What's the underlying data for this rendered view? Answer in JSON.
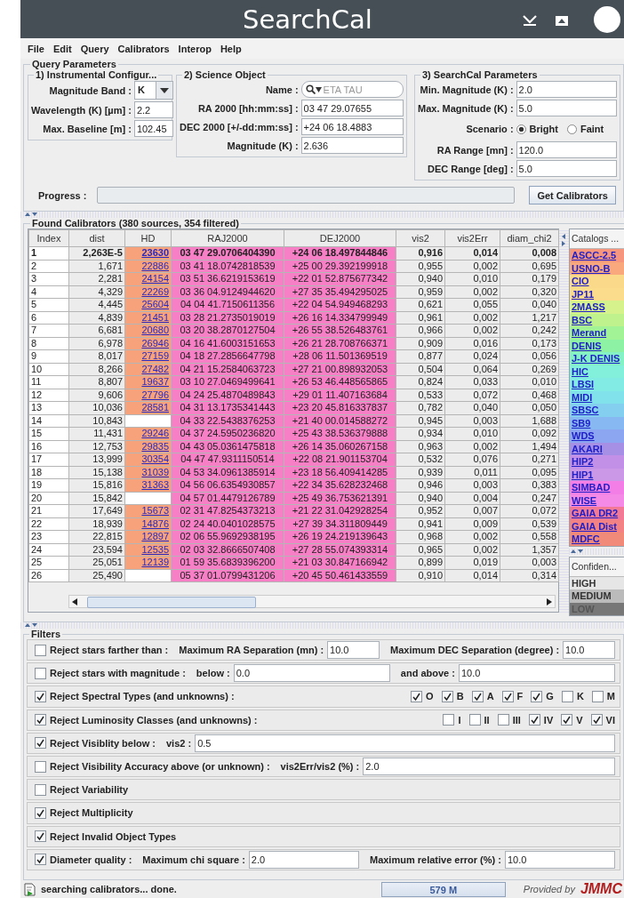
{
  "window": {
    "title": "SearchCal"
  },
  "menu": [
    "File",
    "Edit",
    "Query",
    "Calibrators",
    "Interop",
    "Help"
  ],
  "query_parameters": {
    "title": "Query Parameters",
    "instrumental": {
      "title": "1) Instrumental Configur...",
      "fields": [
        {
          "kind": "combo",
          "label": "Magnitude Band :",
          "value": "K"
        },
        {
          "kind": "text",
          "label": "Wavelength (K) [µm] :",
          "value": "2.2"
        },
        {
          "kind": "text",
          "label": "Max. Baseline [m] :",
          "value": "102.45"
        }
      ]
    },
    "science_object": {
      "title": "2) Science Object",
      "fields": [
        {
          "kind": "search",
          "label": "Name :",
          "placeholder": "ETA TAU"
        },
        {
          "kind": "text",
          "label": "RA 2000 [hh:mm:ss] :",
          "value": "03 47 29.07655"
        },
        {
          "kind": "text",
          "label": "DEC 2000 [+/-dd:mm:ss] :",
          "value": "+24 06 18.4883"
        },
        {
          "kind": "text",
          "label": "Magnitude (K) :",
          "value": "2.636"
        }
      ]
    },
    "searchcal": {
      "title": "3) SearchCal Parameters",
      "fields": [
        {
          "kind": "text",
          "label": "Min. Magnitude (K) :",
          "value": "2.0"
        },
        {
          "kind": "text",
          "label": "Max. Magnitude (K) :",
          "value": "5.0"
        },
        {
          "kind": "radio",
          "label": "Scenario :",
          "options": [
            {
              "label": "Bright",
              "selected": true
            },
            {
              "label": "Faint",
              "selected": false
            }
          ]
        },
        {
          "kind": "text",
          "label": "RA Range [mn] :",
          "value": "120.0"
        },
        {
          "kind": "text",
          "label": "DEC Range [deg] :",
          "value": "5.0"
        }
      ]
    },
    "progress_label": "Progress :",
    "button": "Get Calibrators"
  },
  "results": {
    "title": "Found Calibrators (380 sources, 354 filtered)",
    "columns": [
      "Index",
      "dist",
      "HD",
      "RAJ2000",
      "DEJ2000",
      "vis2",
      "vis2Err",
      "diam_chi2"
    ],
    "rows": [
      {
        "bold": true,
        "index": "1",
        "dist": "2,263E-5",
        "hd": "23630",
        "raj2000": "03 47 29.0706404390",
        "dej2000": "+24 06 18.497844846",
        "vis2": "0,916",
        "vis2err": "0,014",
        "diam_chi2": "0,008"
      },
      {
        "bold": false,
        "index": "2",
        "dist": "1,671",
        "hd": "22886",
        "raj2000": "03 41 18.0742818539",
        "dej2000": "+25 00 29.392199918",
        "vis2": "0,955",
        "vis2err": "0,002",
        "diam_chi2": "0,695"
      },
      {
        "bold": false,
        "index": "3",
        "dist": "2,281",
        "hd": "24154",
        "raj2000": "03 51 36.6219153619",
        "dej2000": "+22 01 52.875677342",
        "vis2": "0,940",
        "vis2err": "0,010",
        "diam_chi2": "0,179"
      },
      {
        "bold": false,
        "index": "4",
        "dist": "4,329",
        "hd": "22269",
        "raj2000": "03 36 04.9124944620",
        "dej2000": "+27 35 35.494295025",
        "vis2": "0,959",
        "vis2err": "0,002",
        "diam_chi2": "0,320"
      },
      {
        "bold": false,
        "index": "5",
        "dist": "4,445",
        "hd": "25604",
        "raj2000": "04 04 41.7150611356",
        "dej2000": "+22 04 54.949468293",
        "vis2": "0,621",
        "vis2err": "0,055",
        "diam_chi2": "0,040"
      },
      {
        "bold": false,
        "index": "6",
        "dist": "4,839",
        "hd": "21451",
        "raj2000": "03 28 21.2735019019",
        "dej2000": "+26 16 14.334799949",
        "vis2": "0,961",
        "vis2err": "0,002",
        "diam_chi2": "1,217"
      },
      {
        "bold": false,
        "index": "7",
        "dist": "6,681",
        "hd": "20680",
        "raj2000": "03 20 38.2870127504",
        "dej2000": "+26 55 38.526483761",
        "vis2": "0,966",
        "vis2err": "0,002",
        "diam_chi2": "0,242"
      },
      {
        "bold": false,
        "index": "8",
        "dist": "6,978",
        "hd": "26946",
        "raj2000": "04 16 41.6003151653",
        "dej2000": "+26 21 28.708766371",
        "vis2": "0,909",
        "vis2err": "0,016",
        "diam_chi2": "0,173"
      },
      {
        "bold": false,
        "index": "9",
        "dist": "8,017",
        "hd": "27159",
        "raj2000": "04 18 27.2856647798",
        "dej2000": "+28 06 11.501369519",
        "vis2": "0,877",
        "vis2err": "0,024",
        "diam_chi2": "0,056"
      },
      {
        "bold": false,
        "index": "10",
        "dist": "8,266",
        "hd": "27482",
        "raj2000": "04 21 15.2584063723",
        "dej2000": "+27 21 00.898932053",
        "vis2": "0,504",
        "vis2err": "0,064",
        "diam_chi2": "0,269"
      },
      {
        "bold": false,
        "index": "11",
        "dist": "8,807",
        "hd": "19637",
        "raj2000": "03 10 27.0469499641",
        "dej2000": "+26 53 46.448565865",
        "vis2": "0,824",
        "vis2err": "0,033",
        "diam_chi2": "0,010"
      },
      {
        "bold": false,
        "index": "12",
        "dist": "9,606",
        "hd": "27796",
        "raj2000": "04 24 25.4870489843",
        "dej2000": "+29 01 11.407163684",
        "vis2": "0,533",
        "vis2err": "0,072",
        "diam_chi2": "0,468"
      },
      {
        "bold": false,
        "index": "13",
        "dist": "10,036",
        "hd": "28581",
        "raj2000": "04 31 13.1735341443",
        "dej2000": "+23 20 45.816337837",
        "vis2": "0,782",
        "vis2err": "0,040",
        "diam_chi2": "0,050"
      },
      {
        "bold": false,
        "index": "14",
        "dist": "10,843",
        "raj2000": "04 33 22.5438376253",
        "dej2000": "+21 40 00.014588272",
        "vis2": "0,945",
        "vis2err": "0,003",
        "diam_chi2": "1,688"
      },
      {
        "bold": false,
        "index": "15",
        "dist": "11,431",
        "hd": "29246",
        "raj2000": "04 37 24.5950236820",
        "dej2000": "+25 43 38.536379888",
        "vis2": "0,934",
        "vis2err": "0,010",
        "diam_chi2": "0,092"
      },
      {
        "bold": false,
        "index": "16",
        "dist": "12,753",
        "hd": "29835",
        "raj2000": "04 43 05.0361475818",
        "dej2000": "+26 14 35.060267158",
        "vis2": "0,963",
        "vis2err": "0,002",
        "diam_chi2": "1,494"
      },
      {
        "bold": false,
        "index": "17",
        "dist": "13,999",
        "hd": "30354",
        "raj2000": "04 47 47.9311150514",
        "dej2000": "+22 08 21.901153704",
        "vis2": "0,532",
        "vis2err": "0,076",
        "diam_chi2": "0,271"
      },
      {
        "bold": false,
        "index": "18",
        "dist": "15,138",
        "hd": "31039",
        "raj2000": "04 53 34.0961385914",
        "dej2000": "+23 18 56.409414285",
        "vis2": "0,939",
        "vis2err": "0,011",
        "diam_chi2": "0,095"
      },
      {
        "bold": false,
        "index": "19",
        "dist": "15,816",
        "hd": "31363",
        "raj2000": "04 56 06.6354930857",
        "dej2000": "+22 34 35.628232468",
        "vis2": "0,946",
        "vis2err": "0,003",
        "diam_chi2": "0,383"
      },
      {
        "bold": false,
        "index": "20",
        "dist": "15,842",
        "raj2000": "04 57 01.4479126789",
        "dej2000": "+25 49 36.753621391",
        "vis2": "0,940",
        "vis2err": "0,004",
        "diam_chi2": "0,247"
      },
      {
        "bold": false,
        "index": "21",
        "dist": "17,649",
        "hd": "15673",
        "raj2000": "02 31 47.8254373213",
        "dej2000": "+21 22 31.042928254",
        "vis2": "0,952",
        "vis2err": "0,007",
        "diam_chi2": "0,072"
      },
      {
        "bold": false,
        "index": "22",
        "dist": "18,939",
        "hd": "14876",
        "raj2000": "02 24 40.0401028575",
        "dej2000": "+27 39 34.311809449",
        "vis2": "0,941",
        "vis2err": "0,009",
        "diam_chi2": "0,539"
      },
      {
        "bold": false,
        "index": "23",
        "dist": "22,815",
        "hd": "12897",
        "raj2000": "02 06 55.9692938195",
        "dej2000": "+26 19 24.219139643",
        "vis2": "0,968",
        "vis2err": "0,002",
        "diam_chi2": "0,558"
      },
      {
        "bold": false,
        "index": "24",
        "dist": "23,594",
        "hd": "12535",
        "raj2000": "02 03 32.8666507408",
        "dej2000": "+27 28 55.074393314",
        "vis2": "0,965",
        "vis2err": "0,002",
        "diam_chi2": "1,357"
      },
      {
        "bold": false,
        "index": "25",
        "dist": "25,051",
        "hd": "12139",
        "raj2000": "01 59 35.6839396200",
        "dej2000": "+21 03 30.847166942",
        "vis2": "0,899",
        "vis2err": "0,019",
        "diam_chi2": "0,003"
      },
      {
        "bold": false,
        "index": "26",
        "dist": "25,490",
        "raj2000": "05 37 01.0799431206",
        "dej2000": "+20 45 50.461433559",
        "vis2": "0,910",
        "vis2err": "0,014",
        "diam_chi2": "0,314"
      }
    ],
    "catalogs": {
      "title": "Catalogs ...",
      "items": [
        {
          "label": "ASCC-2.5",
          "color": "#f7967e"
        },
        {
          "label": "USNO-B",
          "color": "#f9a87e"
        },
        {
          "label": "CIO",
          "color": "#fbd98a"
        },
        {
          "label": "JP11",
          "color": "#fbdc8c"
        },
        {
          "label": "2MASS",
          "color": "#d6f28c"
        },
        {
          "label": "BSC",
          "color": "#bff28c"
        },
        {
          "label": "Merand",
          "color": "#a2f296"
        },
        {
          "label": "DENIS",
          "color": "#8ef2a4"
        },
        {
          "label": "J-K DENIS",
          "color": "#84f2c4"
        },
        {
          "label": "HIC",
          "color": "#82f0da"
        },
        {
          "label": "LBSI",
          "color": "#82ece4"
        },
        {
          "label": "MIDI",
          "color": "#82e2ec"
        },
        {
          "label": "SBSC",
          "color": "#84cff0"
        },
        {
          "label": "SB9",
          "color": "#88b8f2"
        },
        {
          "label": "WDS",
          "color": "#8ca6f2"
        },
        {
          "label": "AKARI",
          "color": "#a690e6"
        },
        {
          "label": "HIP2",
          "color": "#c290e6"
        },
        {
          "label": "HIP1",
          "color": "#ca98e6"
        },
        {
          "label": "SIMBAD",
          "color": "#f27ee6"
        },
        {
          "label": "WISE",
          "color": "#f48ae6"
        },
        {
          "label": "GAIA DR2",
          "color": "#f27a96"
        },
        {
          "label": "GAIA Dist",
          "color": "#f28284"
        },
        {
          "label": "MDFC",
          "color": "#f28a7a"
        }
      ]
    },
    "confidence": {
      "title": "Confiden...",
      "items": [
        {
          "label": "HIGH",
          "color": "#e6e6e6"
        },
        {
          "label": "MEDIUM",
          "color": "#bbbbbb"
        },
        {
          "label": "LOW",
          "color": "#777777"
        }
      ]
    }
  },
  "filters": {
    "title": "Filters",
    "rows": [
      {
        "kind": "params",
        "checked": false,
        "label": "Reject stars farther than :",
        "params": [
          {
            "label": "Maximum RA Separation (mn) :",
            "value": "10.0"
          },
          {
            "label": "Maximum DEC Separation (degree) :",
            "value": "10.0"
          }
        ]
      },
      {
        "kind": "params",
        "checked": false,
        "label": "Reject stars with magnitude :",
        "params": [
          {
            "label": "below :",
            "value": "0.0"
          },
          {
            "label": "and above :",
            "value": "10.0"
          }
        ]
      },
      {
        "kind": "options",
        "checked": true,
        "label": "Reject Spectral Types (and unknowns) :",
        "options": [
          {
            "label": "O",
            "checked": true
          },
          {
            "label": "B",
            "checked": true
          },
          {
            "label": "A",
            "checked": true
          },
          {
            "label": "F",
            "checked": true
          },
          {
            "label": "G",
            "checked": true
          },
          {
            "label": "K",
            "checked": false
          },
          {
            "label": "M",
            "checked": false
          }
        ]
      },
      {
        "kind": "options",
        "checked": true,
        "label": "Reject Luminosity Classes (and unknowns) :",
        "options": [
          {
            "label": "I",
            "checked": false
          },
          {
            "label": "II",
            "checked": false
          },
          {
            "label": "III",
            "checked": false
          },
          {
            "label": "IV",
            "checked": true
          },
          {
            "label": "V",
            "checked": true
          },
          {
            "label": "VI",
            "checked": true
          }
        ]
      },
      {
        "kind": "params",
        "checked": true,
        "label": "Reject Visiblity below :",
        "params": [
          {
            "label": "vis2 :",
            "value": "0.5"
          }
        ]
      },
      {
        "kind": "params",
        "checked": false,
        "label": "Reject Visibility Accuracy above (or unknown) :",
        "params": [
          {
            "label": "vis2Err/vis2 (%) :",
            "value": "2.0"
          }
        ]
      },
      {
        "kind": "plain",
        "checked": false,
        "label": "Reject Variability"
      },
      {
        "kind": "plain",
        "checked": true,
        "label": "Reject Multiplicity"
      },
      {
        "kind": "plain",
        "checked": true,
        "label": "Reject Invalid Object Types"
      },
      {
        "kind": "params",
        "checked": true,
        "label": "Diameter quality :",
        "params": [
          {
            "label": "Maximum chi square :",
            "value": "2.0"
          },
          {
            "label": "Maximum relative error (%) :",
            "value": "10.0"
          }
        ]
      }
    ]
  },
  "status_bar": {
    "message": "searching calibrators... done.",
    "memory": "579 M",
    "provided_by": "Provided by",
    "logo": "JMMC"
  }
}
